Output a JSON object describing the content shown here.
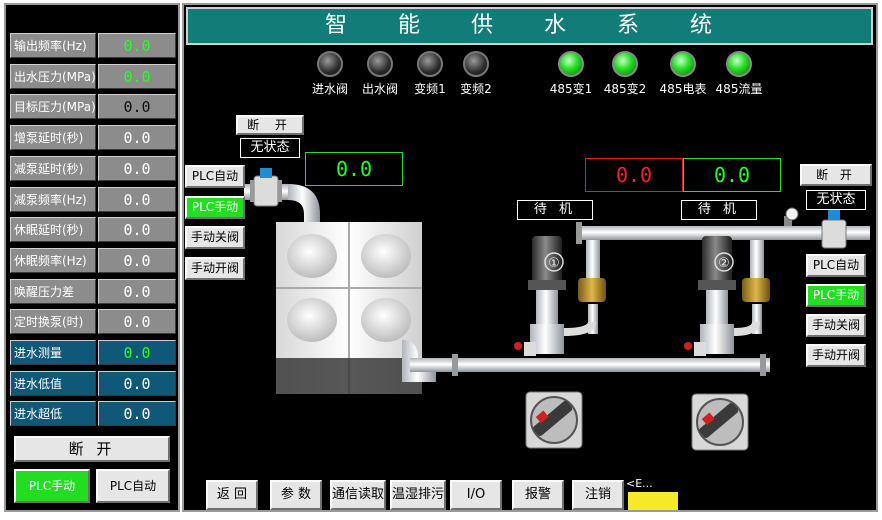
{
  "title": "智 能 供 水 系 统",
  "params": [
    {
      "label": "输出频率(Hz)",
      "value": "0.0",
      "style": "green"
    },
    {
      "label": "出水压力(MPa)",
      "value": "0.0",
      "style": "green"
    },
    {
      "label": "目标压力(MPa)",
      "value": "0.0",
      "style": "dark"
    },
    {
      "label": "增泵延时(秒)",
      "value": "0.0",
      "style": "white"
    },
    {
      "label": "减泵延时(秒)",
      "value": "0.0",
      "style": "white"
    },
    {
      "label": "减泵频率(Hz)",
      "value": "0.0",
      "style": "white"
    },
    {
      "label": "休眠延时(秒)",
      "value": "0.0",
      "style": "white"
    },
    {
      "label": "休眠频率(Hz)",
      "value": "0.0",
      "style": "white"
    },
    {
      "label": "唤醒压力差",
      "value": "0.0",
      "style": "white"
    },
    {
      "label": "定时换泵(时)",
      "value": "0.0",
      "style": "white"
    },
    {
      "label": "进水测量",
      "value": "0.0",
      "style": "blue-green"
    },
    {
      "label": "进水低值",
      "value": "0.0",
      "style": "blue"
    },
    {
      "label": "进水超低",
      "value": "0.0",
      "style": "blue"
    }
  ],
  "left_panel": {
    "disconnect": "断  开",
    "plc_manual": "PLC手动",
    "plc_auto": "PLC自动"
  },
  "indicators": [
    {
      "label": "进水阀",
      "state": "off"
    },
    {
      "label": "出水阀",
      "state": "off"
    },
    {
      "label": "变频1",
      "state": "off"
    },
    {
      "label": "变频2",
      "state": "off"
    },
    {
      "label": "485变1",
      "state": "on"
    },
    {
      "label": "485变2",
      "state": "on"
    },
    {
      "label": "485电表",
      "state": "on"
    },
    {
      "label": "485流量",
      "state": "on"
    }
  ],
  "inlet": {
    "disconnect": "断  开",
    "status": "无状态",
    "reading": "0.0",
    "buttons": [
      "PLC自动",
      "PLC手动",
      "手动关阀",
      "手动开阀"
    ],
    "active": "PLC手动"
  },
  "outlet": {
    "disconnect": "断    开",
    "status": "无状态",
    "buttons": [
      "PLC自动",
      "PLC手动",
      "手动关阀",
      "手动开阀"
    ],
    "active": "PLC手动"
  },
  "pumps": [
    {
      "number": "①",
      "status": "待  机",
      "reading": "0.0",
      "reading_color": "red"
    },
    {
      "number": "②",
      "status": "待  机",
      "reading": "0.0",
      "reading_color": "green"
    }
  ],
  "bottom_nav": [
    "返 回",
    "参 数",
    "通信读取",
    "温湿排污",
    "I/O",
    "报警",
    "注销"
  ],
  "bottom_status": "<E..."
}
